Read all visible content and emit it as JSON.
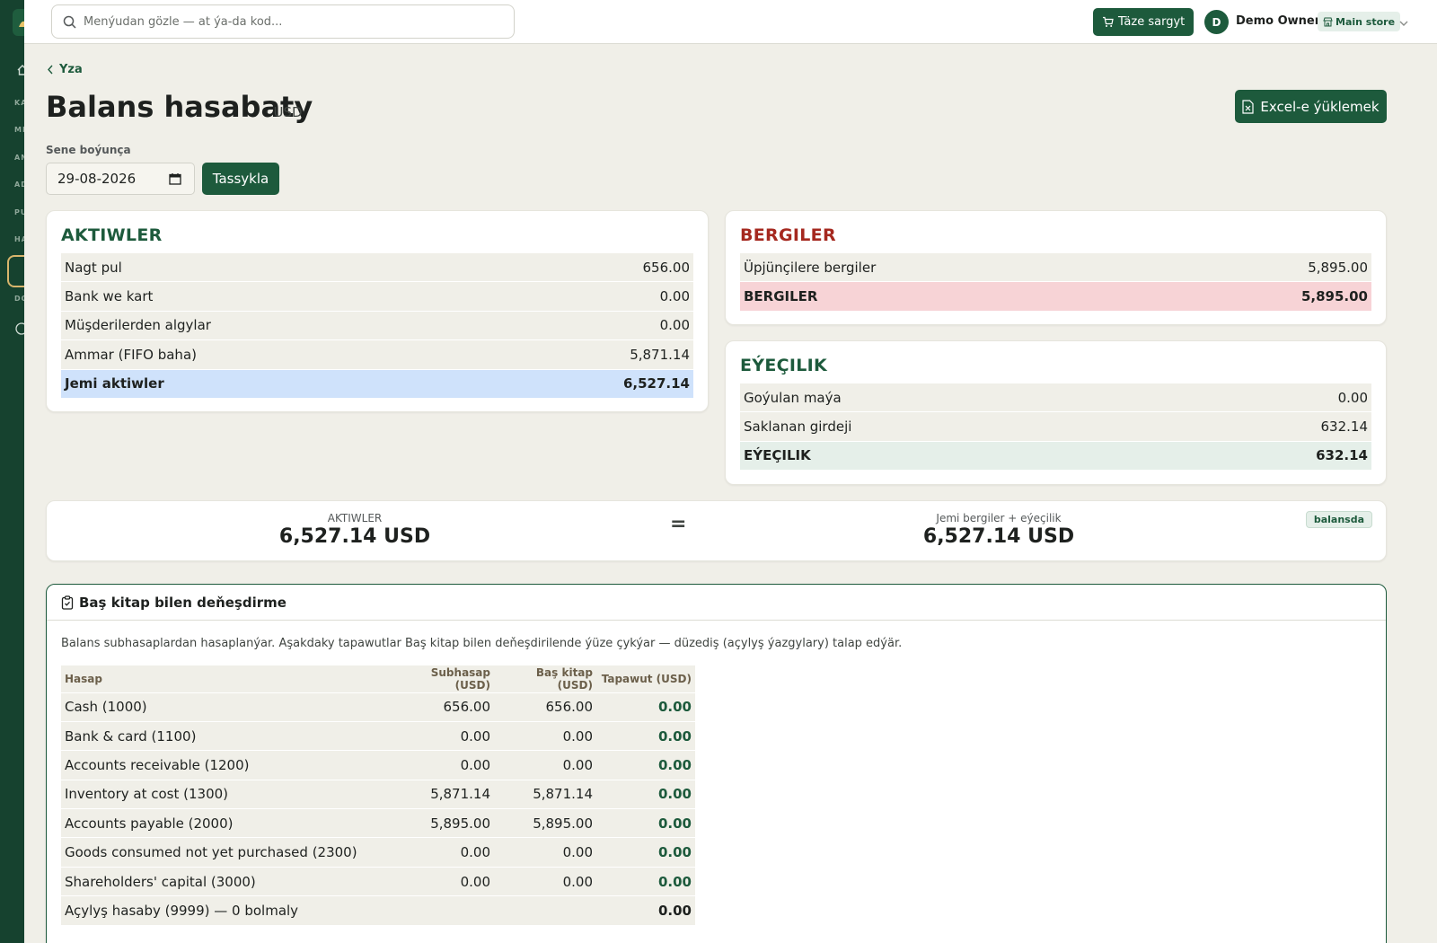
{
  "colors": {
    "brand": "#1d5a3c",
    "sidebar": "#16422f",
    "liabilities_title": "#a5281f",
    "assets_total_bg": "#cfe2fb",
    "liabilities_total_bg": "#f7d3d6",
    "equity_total_bg": "#e5efe9"
  },
  "sidebar": {
    "labels": [
      "KA",
      "ME",
      "AN",
      "AD",
      "PU",
      "HA",
      "DO"
    ]
  },
  "topbar": {
    "search_placeholder": "Menýudan gözle — at ýa-da kod...",
    "new_sale_label": "Täze sargyt",
    "avatar_initial": "D",
    "user_name": "Demo Owner",
    "store_label": "Main store"
  },
  "page": {
    "back_label": "Yza",
    "title": "Balans hasabaty",
    "currency_suffix": "· USD",
    "export_label": "Excel-e ýüklemek",
    "date_label": "Sene boýunça",
    "date_value": "29-08-2026",
    "confirm_label": "Tassykla"
  },
  "assets": {
    "title": "AKTIWLER",
    "rows": [
      {
        "label": "Nagt pul",
        "value": "656.00"
      },
      {
        "label": "Bank we kart",
        "value": "0.00"
      },
      {
        "label": "Müşderilerden algylar",
        "value": "0.00"
      },
      {
        "label": "Ammar (FIFO baha)",
        "value": "5,871.14"
      }
    ],
    "total": {
      "label": "Jemi aktiwler",
      "value": "6,527.14"
    }
  },
  "liabilities": {
    "title": "BERGILER",
    "rows": [
      {
        "label": "Üpjünçilere bergiler",
        "value": "5,895.00"
      }
    ],
    "total": {
      "label": "BERGILER",
      "value": "5,895.00"
    }
  },
  "equity": {
    "title": "EÝEÇILIK",
    "rows": [
      {
        "label": "Goýulan maýa",
        "value": "0.00"
      },
      {
        "label": "Saklanan girdeji",
        "value": "632.14"
      }
    ],
    "total": {
      "label": "EÝEÇILIK",
      "value": "632.14"
    }
  },
  "equation": {
    "left_label": "AKTIWLER",
    "left_value": "6,527.14 USD",
    "sign": "=",
    "right_label": "Jemi bergiler + eýeçilik",
    "right_value": "6,527.14 USD",
    "badge": "balansda"
  },
  "ledger": {
    "title": "Baş kitap bilen deňeşdirme",
    "description": "Balans subhasaplardan hasaplanýar. Aşakdaky tapawutlar Baş kitap bilen deňeşdirilende ýüze çykýar — düzediş (açylyş ýazgylary) talap edýär.",
    "columns": [
      "Hasap",
      "Subhasap (USD)",
      "Baş kitap (USD)",
      "Tapawut (USD)"
    ],
    "rows": [
      [
        "Cash (1000)",
        "656.00",
        "656.00",
        "0.00"
      ],
      [
        "Bank & card (1100)",
        "0.00",
        "0.00",
        "0.00"
      ],
      [
        "Accounts receivable (1200)",
        "0.00",
        "0.00",
        "0.00"
      ],
      [
        "Inventory at cost (1300)",
        "5,871.14",
        "5,871.14",
        "0.00"
      ],
      [
        "Accounts payable (2000)",
        "5,895.00",
        "5,895.00",
        "0.00"
      ],
      [
        "Goods consumed not yet purchased (2300)",
        "0.00",
        "0.00",
        "0.00"
      ],
      [
        "Shareholders' capital (3000)",
        "0.00",
        "0.00",
        "0.00"
      ],
      [
        "Açylyş hasaby (9999) — 0 bolmaly",
        "",
        "",
        "0.00"
      ]
    ]
  }
}
